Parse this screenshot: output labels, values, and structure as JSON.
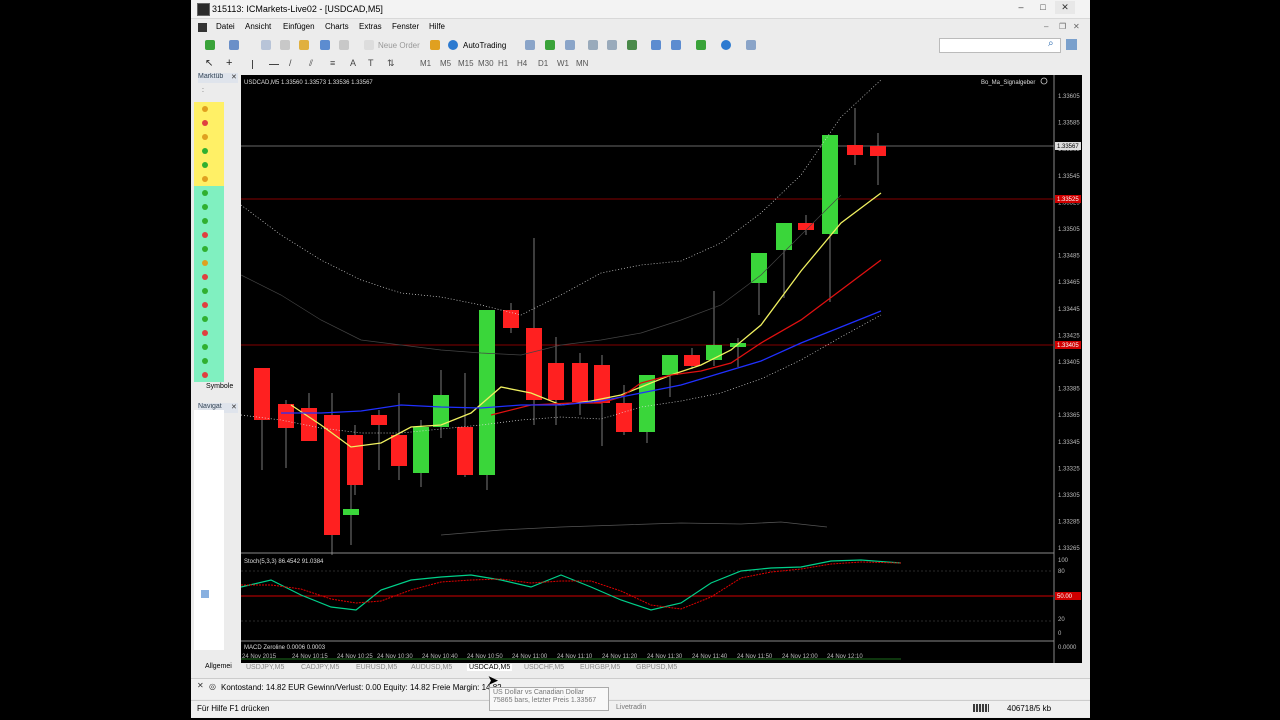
{
  "window": {
    "title": "315113: ICMarkets-Live02 - [USDCAD,M5]",
    "buttons": [
      "minimize",
      "maximize",
      "close"
    ],
    "mdi_buttons": [
      "minimize",
      "restore",
      "close"
    ]
  },
  "menu": [
    "Datei",
    "Ansicht",
    "Einfügen",
    "Charts",
    "Extras",
    "Fenster",
    "Hilfe"
  ],
  "toolbar": {
    "new_order": "Neue Order",
    "autotrading": "AutoTrading",
    "timeframes": [
      "M1",
      "M5",
      "M15",
      "M30",
      "H1",
      "H4",
      "D1",
      "W1",
      "MN"
    ]
  },
  "sidebar": {
    "marketwatch_title": "Marktüb",
    "marketwatch_header": ":",
    "marketwatch_tab": "Symbole",
    "navigator_title": "Navigat",
    "bottom_tab": "Allgemei"
  },
  "chart": {
    "symbol_label": "USDCAD,M5",
    "ohlc": "1.33560 1.33573 1.33536 1.33567",
    "ea_name": "Bo_Ma_Signalgeber",
    "current_price_label": "1.33567",
    "red_level_1": "1.33525",
    "red_level_2": "1.33405",
    "price_scale": [
      "1.33605",
      "1.33585",
      "1.33565",
      "1.33545",
      "1.33525",
      "1.33505",
      "1.33485",
      "1.33465",
      "1.33445",
      "1.33425",
      "1.33405",
      "1.33385",
      "1.33365",
      "1.33345",
      "1.33325",
      "1.33305",
      "1.33285",
      "1.33265"
    ],
    "stoch_label": "Stoch(5,3,3) 86.4542 91.0384",
    "stoch_scale": [
      "100",
      "80",
      "20",
      "0"
    ],
    "stoch_level": "50.00",
    "macd_label": "MACD Zeroline 0.0006 0.0003",
    "macd_scale": "0.0000",
    "time_labels": [
      "24 Nov 2015",
      "24 Nov 10:15",
      "24 Nov 10:25",
      "24 Nov 10:30",
      "24 Nov 10:40",
      "24 Nov 10:50",
      "24 Nov 11:00",
      "24 Nov 11:10",
      "24 Nov 11:20",
      "24 Nov 11:30",
      "24 Nov 11:40",
      "24 Nov 11:50",
      "24 Nov 12:00",
      "24 Nov 12:10"
    ],
    "colors": {
      "bull": "#3ad63a",
      "bear": "#ff2020",
      "ma_fast": "#f0f060",
      "ma_mid": "#e01010",
      "ma_slow": "#2030ff",
      "stoch_main": "#00d08a",
      "stoch_signal": "#e00000"
    }
  },
  "chart_tabs": [
    "USDJPY,M5",
    "CADJPY,M5",
    "EURUSD,M5",
    "AUDUSD,M5",
    "USDCAD,M5",
    "USDCHF,M5",
    "EURGBP,M5",
    "GBPUSD,M5"
  ],
  "terminal": {
    "account_line": "Kontostand: 14.82 EUR  Gewinn/Verlust: 0.00  Equity: 14.82  Freie Margin: 14.82"
  },
  "tooltip": {
    "line1": "US Dollar vs Canadian Dollar",
    "line2": "75865 bars, letzter Preis 1.33567"
  },
  "status": {
    "help": "Für Hilfe F1 drücken",
    "partial": "Livetradin",
    "traffic": "406718/5 kb"
  }
}
